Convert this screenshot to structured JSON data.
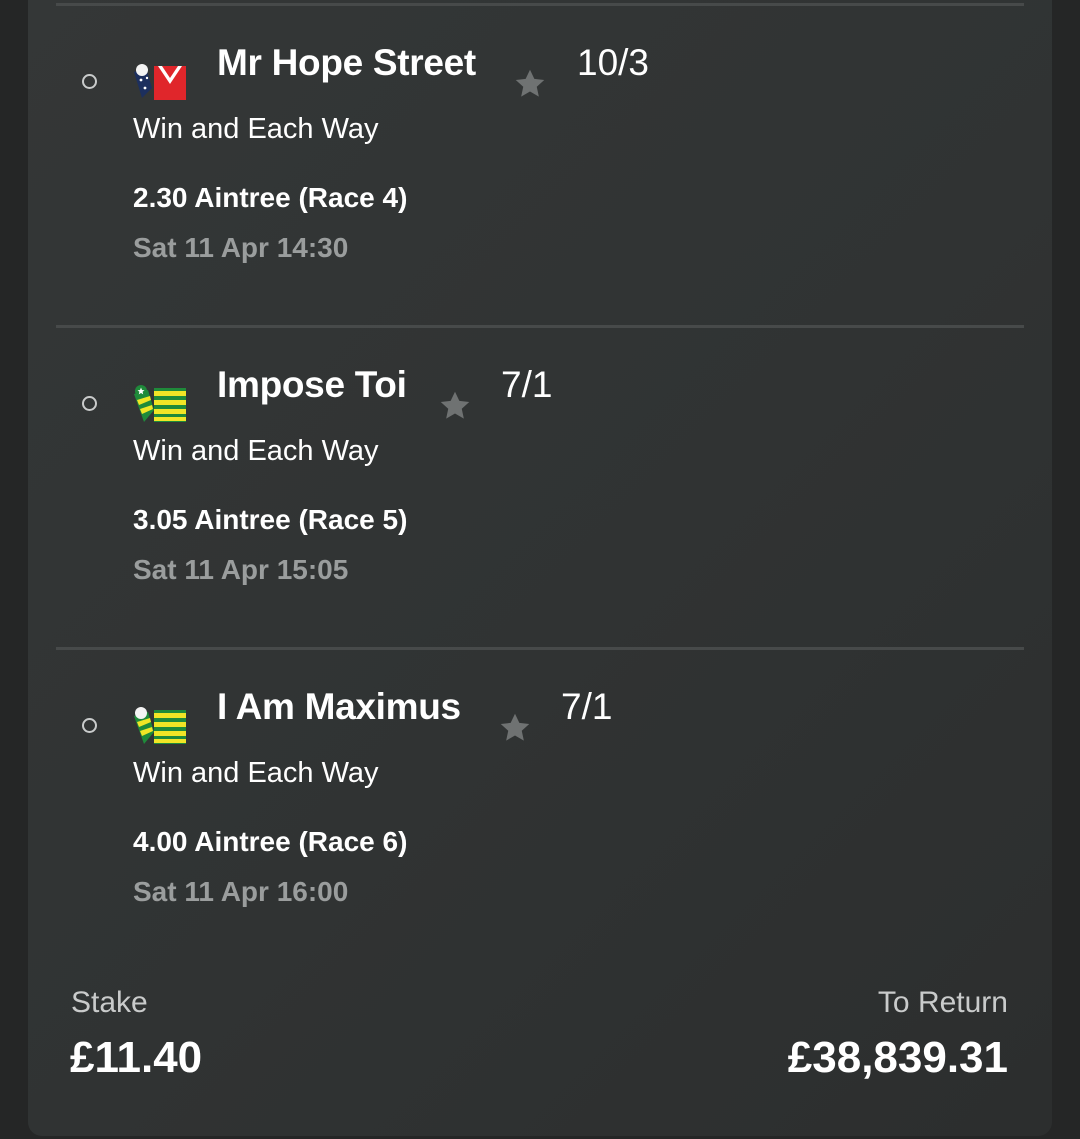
{
  "selections": [
    {
      "runner": "Mr Hope Street",
      "odds": "10/3",
      "market": "Win and Each Way",
      "event": "2.30 Aintree (Race 4)",
      "time": "Sat 11 Apr 14:30",
      "silks_icon": "red-white-silks-icon"
    },
    {
      "runner": "Impose Toi",
      "odds": "7/1",
      "market": "Win and Each Way",
      "event": "3.05 Aintree (Race 5)",
      "time": "Sat 11 Apr 15:05",
      "silks_icon": "green-yellow-silks-icon"
    },
    {
      "runner": "I Am Maximus",
      "odds": "7/1",
      "market": "Win and Each Way",
      "event": "4.00 Aintree (Race 6)",
      "time": "Sat 11 Apr 16:00",
      "silks_icon": "green-yellow-silks-icon"
    }
  ],
  "footer": {
    "stake_label": "Stake",
    "stake_value": "£11.40",
    "return_label": "To Return",
    "return_value": "£38,839.31"
  },
  "colors": {
    "background": "#252626",
    "card": "#323535",
    "divider": "#474a4a",
    "text_primary": "#ffffff",
    "text_muted": "#9a9d9d",
    "star": "#6f7272"
  }
}
